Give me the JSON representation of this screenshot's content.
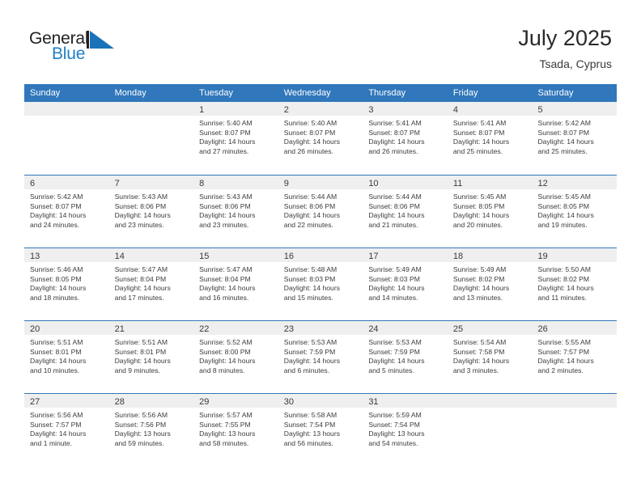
{
  "brand": {
    "name_part1": "General",
    "name_part2": "Blue",
    "logo_icon": "triangle-flag-icon"
  },
  "header": {
    "title": "July 2025",
    "subtitle": "Tsada, Cyprus"
  },
  "colors": {
    "header_blue": "#3077bb",
    "date_strip_gray": "#efefef",
    "brand_blue": "#1f7fc4",
    "text": "#3c3c3c"
  },
  "calendar": {
    "weekdays": [
      "Sunday",
      "Monday",
      "Tuesday",
      "Wednesday",
      "Thursday",
      "Friday",
      "Saturday"
    ],
    "weeks": [
      [
        {
          "date": "",
          "sunrise": "",
          "sunset": "",
          "daylight_a": "",
          "daylight_b": ""
        },
        {
          "date": "",
          "sunrise": "",
          "sunset": "",
          "daylight_a": "",
          "daylight_b": ""
        },
        {
          "date": "1",
          "sunrise": "Sunrise: 5:40 AM",
          "sunset": "Sunset: 8:07 PM",
          "daylight_a": "Daylight: 14 hours",
          "daylight_b": "and 27 minutes."
        },
        {
          "date": "2",
          "sunrise": "Sunrise: 5:40 AM",
          "sunset": "Sunset: 8:07 PM",
          "daylight_a": "Daylight: 14 hours",
          "daylight_b": "and 26 minutes."
        },
        {
          "date": "3",
          "sunrise": "Sunrise: 5:41 AM",
          "sunset": "Sunset: 8:07 PM",
          "daylight_a": "Daylight: 14 hours",
          "daylight_b": "and 26 minutes."
        },
        {
          "date": "4",
          "sunrise": "Sunrise: 5:41 AM",
          "sunset": "Sunset: 8:07 PM",
          "daylight_a": "Daylight: 14 hours",
          "daylight_b": "and 25 minutes."
        },
        {
          "date": "5",
          "sunrise": "Sunrise: 5:42 AM",
          "sunset": "Sunset: 8:07 PM",
          "daylight_a": "Daylight: 14 hours",
          "daylight_b": "and 25 minutes."
        }
      ],
      [
        {
          "date": "6",
          "sunrise": "Sunrise: 5:42 AM",
          "sunset": "Sunset: 8:07 PM",
          "daylight_a": "Daylight: 14 hours",
          "daylight_b": "and 24 minutes."
        },
        {
          "date": "7",
          "sunrise": "Sunrise: 5:43 AM",
          "sunset": "Sunset: 8:06 PM",
          "daylight_a": "Daylight: 14 hours",
          "daylight_b": "and 23 minutes."
        },
        {
          "date": "8",
          "sunrise": "Sunrise: 5:43 AM",
          "sunset": "Sunset: 8:06 PM",
          "daylight_a": "Daylight: 14 hours",
          "daylight_b": "and 23 minutes."
        },
        {
          "date": "9",
          "sunrise": "Sunrise: 5:44 AM",
          "sunset": "Sunset: 8:06 PM",
          "daylight_a": "Daylight: 14 hours",
          "daylight_b": "and 22 minutes."
        },
        {
          "date": "10",
          "sunrise": "Sunrise: 5:44 AM",
          "sunset": "Sunset: 8:06 PM",
          "daylight_a": "Daylight: 14 hours",
          "daylight_b": "and 21 minutes."
        },
        {
          "date": "11",
          "sunrise": "Sunrise: 5:45 AM",
          "sunset": "Sunset: 8:05 PM",
          "daylight_a": "Daylight: 14 hours",
          "daylight_b": "and 20 minutes."
        },
        {
          "date": "12",
          "sunrise": "Sunrise: 5:45 AM",
          "sunset": "Sunset: 8:05 PM",
          "daylight_a": "Daylight: 14 hours",
          "daylight_b": "and 19 minutes."
        }
      ],
      [
        {
          "date": "13",
          "sunrise": "Sunrise: 5:46 AM",
          "sunset": "Sunset: 8:05 PM",
          "daylight_a": "Daylight: 14 hours",
          "daylight_b": "and 18 minutes."
        },
        {
          "date": "14",
          "sunrise": "Sunrise: 5:47 AM",
          "sunset": "Sunset: 8:04 PM",
          "daylight_a": "Daylight: 14 hours",
          "daylight_b": "and 17 minutes."
        },
        {
          "date": "15",
          "sunrise": "Sunrise: 5:47 AM",
          "sunset": "Sunset: 8:04 PM",
          "daylight_a": "Daylight: 14 hours",
          "daylight_b": "and 16 minutes."
        },
        {
          "date": "16",
          "sunrise": "Sunrise: 5:48 AM",
          "sunset": "Sunset: 8:03 PM",
          "daylight_a": "Daylight: 14 hours",
          "daylight_b": "and 15 minutes."
        },
        {
          "date": "17",
          "sunrise": "Sunrise: 5:49 AM",
          "sunset": "Sunset: 8:03 PM",
          "daylight_a": "Daylight: 14 hours",
          "daylight_b": "and 14 minutes."
        },
        {
          "date": "18",
          "sunrise": "Sunrise: 5:49 AM",
          "sunset": "Sunset: 8:02 PM",
          "daylight_a": "Daylight: 14 hours",
          "daylight_b": "and 13 minutes."
        },
        {
          "date": "19",
          "sunrise": "Sunrise: 5:50 AM",
          "sunset": "Sunset: 8:02 PM",
          "daylight_a": "Daylight: 14 hours",
          "daylight_b": "and 11 minutes."
        }
      ],
      [
        {
          "date": "20",
          "sunrise": "Sunrise: 5:51 AM",
          "sunset": "Sunset: 8:01 PM",
          "daylight_a": "Daylight: 14 hours",
          "daylight_b": "and 10 minutes."
        },
        {
          "date": "21",
          "sunrise": "Sunrise: 5:51 AM",
          "sunset": "Sunset: 8:01 PM",
          "daylight_a": "Daylight: 14 hours",
          "daylight_b": "and 9 minutes."
        },
        {
          "date": "22",
          "sunrise": "Sunrise: 5:52 AM",
          "sunset": "Sunset: 8:00 PM",
          "daylight_a": "Daylight: 14 hours",
          "daylight_b": "and 8 minutes."
        },
        {
          "date": "23",
          "sunrise": "Sunrise: 5:53 AM",
          "sunset": "Sunset: 7:59 PM",
          "daylight_a": "Daylight: 14 hours",
          "daylight_b": "and 6 minutes."
        },
        {
          "date": "24",
          "sunrise": "Sunrise: 5:53 AM",
          "sunset": "Sunset: 7:59 PM",
          "daylight_a": "Daylight: 14 hours",
          "daylight_b": "and 5 minutes."
        },
        {
          "date": "25",
          "sunrise": "Sunrise: 5:54 AM",
          "sunset": "Sunset: 7:58 PM",
          "daylight_a": "Daylight: 14 hours",
          "daylight_b": "and 3 minutes."
        },
        {
          "date": "26",
          "sunrise": "Sunrise: 5:55 AM",
          "sunset": "Sunset: 7:57 PM",
          "daylight_a": "Daylight: 14 hours",
          "daylight_b": "and 2 minutes."
        }
      ],
      [
        {
          "date": "27",
          "sunrise": "Sunrise: 5:56 AM",
          "sunset": "Sunset: 7:57 PM",
          "daylight_a": "Daylight: 14 hours",
          "daylight_b": "and 1 minute."
        },
        {
          "date": "28",
          "sunrise": "Sunrise: 5:56 AM",
          "sunset": "Sunset: 7:56 PM",
          "daylight_a": "Daylight: 13 hours",
          "daylight_b": "and 59 minutes."
        },
        {
          "date": "29",
          "sunrise": "Sunrise: 5:57 AM",
          "sunset": "Sunset: 7:55 PM",
          "daylight_a": "Daylight: 13 hours",
          "daylight_b": "and 58 minutes."
        },
        {
          "date": "30",
          "sunrise": "Sunrise: 5:58 AM",
          "sunset": "Sunset: 7:54 PM",
          "daylight_a": "Daylight: 13 hours",
          "daylight_b": "and 56 minutes."
        },
        {
          "date": "31",
          "sunrise": "Sunrise: 5:59 AM",
          "sunset": "Sunset: 7:54 PM",
          "daylight_a": "Daylight: 13 hours",
          "daylight_b": "and 54 minutes."
        },
        {
          "date": "",
          "sunrise": "",
          "sunset": "",
          "daylight_a": "",
          "daylight_b": ""
        },
        {
          "date": "",
          "sunrise": "",
          "sunset": "",
          "daylight_a": "",
          "daylight_b": ""
        }
      ]
    ]
  }
}
